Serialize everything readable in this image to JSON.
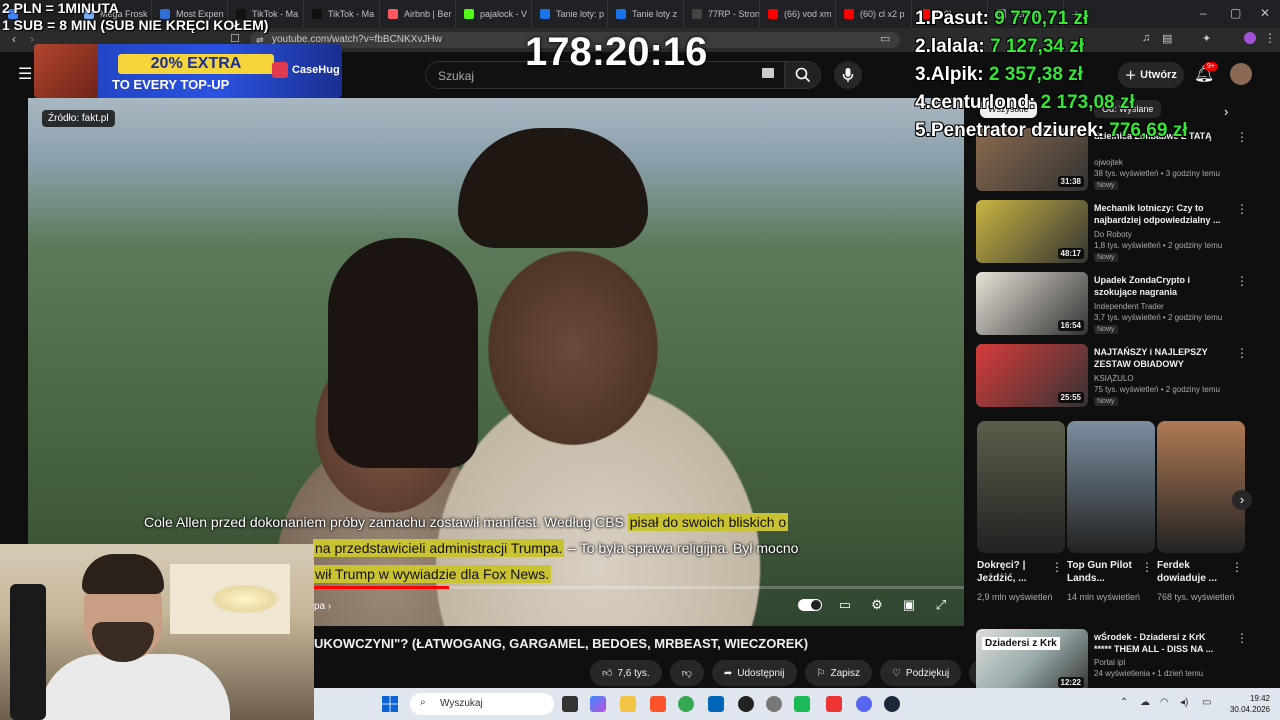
{
  "browser": {
    "tabs": [
      {
        "label": "",
        "color": "#4285f4"
      },
      {
        "label": "Mega Frosk",
        "color": "#7bb3ff"
      },
      {
        "label": "Most Expen",
        "color": "#2f6fd6"
      },
      {
        "label": "TikTok - Ma",
        "color": "#111111"
      },
      {
        "label": "TikTok - Ma",
        "color": "#111111"
      },
      {
        "label": "Airbnb | Ber",
        "color": "#ff5a5f"
      },
      {
        "label": "pajalock - V",
        "color": "#53fc18"
      },
      {
        "label": "Tanie loty: p",
        "color": "#1a73e8"
      },
      {
        "label": "Tanie loty z",
        "color": "#1a73e8"
      },
      {
        "label": "77RP - Stron",
        "color": "#444444"
      },
      {
        "label": "(66) vod xm",
        "color": "#ff0000"
      },
      {
        "label": "(60) cl x2 p",
        "color": "#ff0000"
      },
      {
        "label": "(60)",
        "color": "#ff0000"
      },
      {
        "label": "Ver Mir",
        "color": "#888888"
      }
    ],
    "url": "youtube.com/watch?v=fbBCNKXvJHw",
    "new_tab": "+"
  },
  "youtube": {
    "search_placeholder": "Szukaj",
    "create_label": "Utwórz",
    "notifications_badge": "9+",
    "video": {
      "source_label": "Źródło: fakt.pl",
      "subtitle_line1_plain": "Cole Allen przed dokonaniem próby zamachu zostawił manifest. Według CBS ",
      "subtitle_line1_hl": "pisał do swoich bliskich o",
      "subtitle_line2_hl": "na przedstawicieli administracji Trumpa.",
      "subtitle_line2_plain": " – To była sprawa religijna. Był mocno",
      "subtitle_line3_hl": "wił Trump w wywiadzie dla Fox News.",
      "chapter_label": "pa ›",
      "title": "UKOWCZYNI\"? (ŁATWOGANG, GARGAMEL, BEDOES, MRBEAST, WIECZOREK)",
      "progress": 0.45
    },
    "actions": {
      "likes": "7,6 tys.",
      "share": "Udostępnij",
      "save": "Zapisz",
      "thanks": "Podziękuj",
      "more": "⋯"
    },
    "chips": {
      "first": "Wszystkie",
      "second": "Od: Wyslane"
    },
    "recommendations": [
      {
        "title": "dzielnica Zimbabwe Z TATĄ",
        "channel": "ojwojtek",
        "meta": "38 tys. wyświetleń • 3 godziny temu",
        "badge": "Nowy",
        "duration": "31:38",
        "color": "#8a6a4e"
      },
      {
        "title": "Mechanik lotniczy: Czy to najbardziej odpowiedzialny ...",
        "channel": "Do Roboty",
        "meta": "1,8 tys. wyświetleń • 2 godziny temu",
        "badge": "Nowy",
        "duration": "48:17",
        "color": "#c9b542"
      },
      {
        "title": "Upadek ZondaCrypto i szokujące nagrania",
        "channel": "Independent Trader",
        "meta": "3,7 tys. wyświetleń • 2 godziny temu",
        "badge": "Nowy",
        "duration": "16:54",
        "color": "#e8e2d8"
      },
      {
        "title": "NAJTAŃSZY i NAJLEPSZY ZESTAW OBIADOWY",
        "channel": "KSIĄŻULO",
        "meta": "75 tys. wyświetleń • 2 godziny temu",
        "badge": "Nowy",
        "duration": "25:55",
        "color": "#d83b3b"
      }
    ],
    "shorts": [
      {
        "title": "Dokręci? | Jeżdżić, ...",
        "views": "2,9 mln wyświetleń",
        "color": "#5a5f4a"
      },
      {
        "title": "Top Gun Pilot Lands...",
        "views": "14 mln wyświetleń",
        "color": "#7c8ea0"
      },
      {
        "title": "Ferdek dowiaduje ...",
        "views": "768 tys. wyświetleń",
        "color": "#b07a55"
      }
    ],
    "last_rec": {
      "title": "wŚrodek - Dziadersi z KrK ***** THEM ALL - DISS NA ...",
      "channel": "Portal ipl",
      "meta": "24 wyświetlenia • 1 dzień temu",
      "duration": "12:22",
      "thumb_text": "Dziadersi z Krk"
    }
  },
  "stream_overlay": {
    "timer": "178:20:16",
    "rule1": "2 PLN = 1MINUTA",
    "rule2": "1 SUB = 8 MIN (SUB NIE KRĘCI KOŁEM)",
    "leaderboard": [
      {
        "rank": "1.",
        "name": "Pasut:",
        "amount": "9 770,71 zł"
      },
      {
        "rank": "2.",
        "name": "lalala:",
        "amount": "7 127,34 zł"
      },
      {
        "rank": "3.",
        "name": "Alpik:",
        "amount": "2 357,38 zł"
      },
      {
        "rank": "4.",
        "name": "centurlond:",
        "amount": "2 173,08 zł"
      },
      {
        "rank": "5.",
        "name": "Penetrator dziurek:",
        "amount": "776,69 zł"
      }
    ],
    "ad": {
      "line1": "20% EXTRA",
      "line2": "TO EVERY TOP-UP",
      "brand": "CaseHug"
    }
  },
  "taskbar": {
    "search_placeholder": "Wyszukaj",
    "time": "19:42",
    "date": "30.04.2026"
  }
}
